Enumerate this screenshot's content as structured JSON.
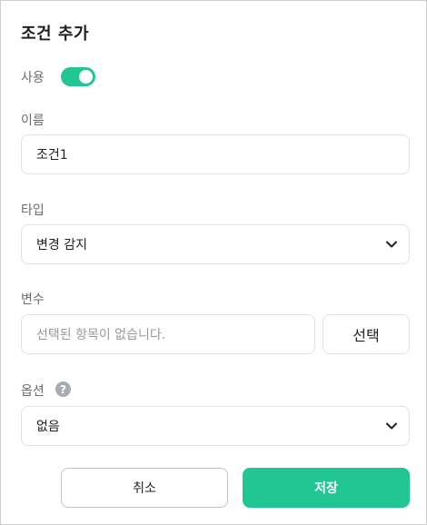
{
  "dialog": {
    "title": "조건 추가"
  },
  "use": {
    "label": "사용",
    "enabled": true
  },
  "name": {
    "label": "이름",
    "value": "조건1"
  },
  "type": {
    "label": "타입",
    "selected": "변경 감지"
  },
  "variable": {
    "label": "변수",
    "placeholder": "선택된 항목이 없습니다.",
    "select_button": "선택"
  },
  "options": {
    "label": "옵션",
    "help_glyph": "?",
    "selected": "없음"
  },
  "footer": {
    "cancel_label": "취소",
    "save_label": "저장"
  },
  "colors": {
    "accent": "#22c693",
    "help_icon": "#a9adb3"
  }
}
